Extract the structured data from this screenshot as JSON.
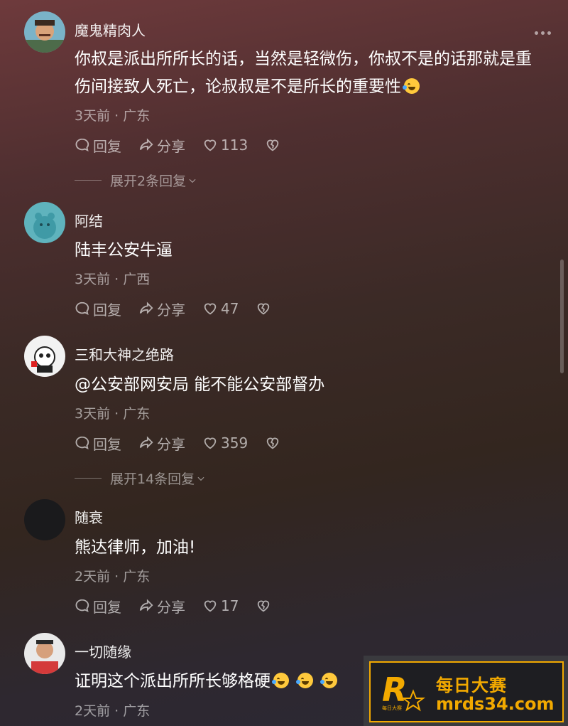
{
  "colors": {
    "watermark_accent": "#f2a900",
    "emoji": "#ffc93c"
  },
  "comments": [
    {
      "username": "魔鬼精肉人",
      "text": "你叔是派出所所长的话，当然是轻微伤，你叔不是的话那就是重伤间接致人死亡，论叔叔是不是所长的重要性",
      "meta": "3天前 · 广东",
      "reply_label": "回复",
      "share_label": "分享",
      "likes": "113",
      "expand_label": "展开2条回复"
    },
    {
      "username": "阿结",
      "text": "陆丰公安牛逼",
      "meta": "3天前 · 广西",
      "reply_label": "回复",
      "share_label": "分享",
      "likes": "47"
    },
    {
      "username": "三和大神之绝路",
      "text": "@公安部网安局 能不能公安部督办",
      "meta": "3天前 · 广东",
      "reply_label": "回复",
      "share_label": "分享",
      "likes": "359",
      "expand_label": "展开14条回复"
    },
    {
      "username": "随衰",
      "text": "熊达律师，加油!",
      "meta": "2天前 · 广东",
      "reply_label": "回复",
      "share_label": "分享",
      "likes": "17"
    },
    {
      "username": "一切随缘",
      "text": "证明这个派出所所长够格硬",
      "meta": "2天前 · 广东"
    }
  ],
  "watermark": {
    "logo_letter": "R",
    "logo_small_text": "每日大赛",
    "title": "每日大赛",
    "url": "mrds34.com"
  }
}
